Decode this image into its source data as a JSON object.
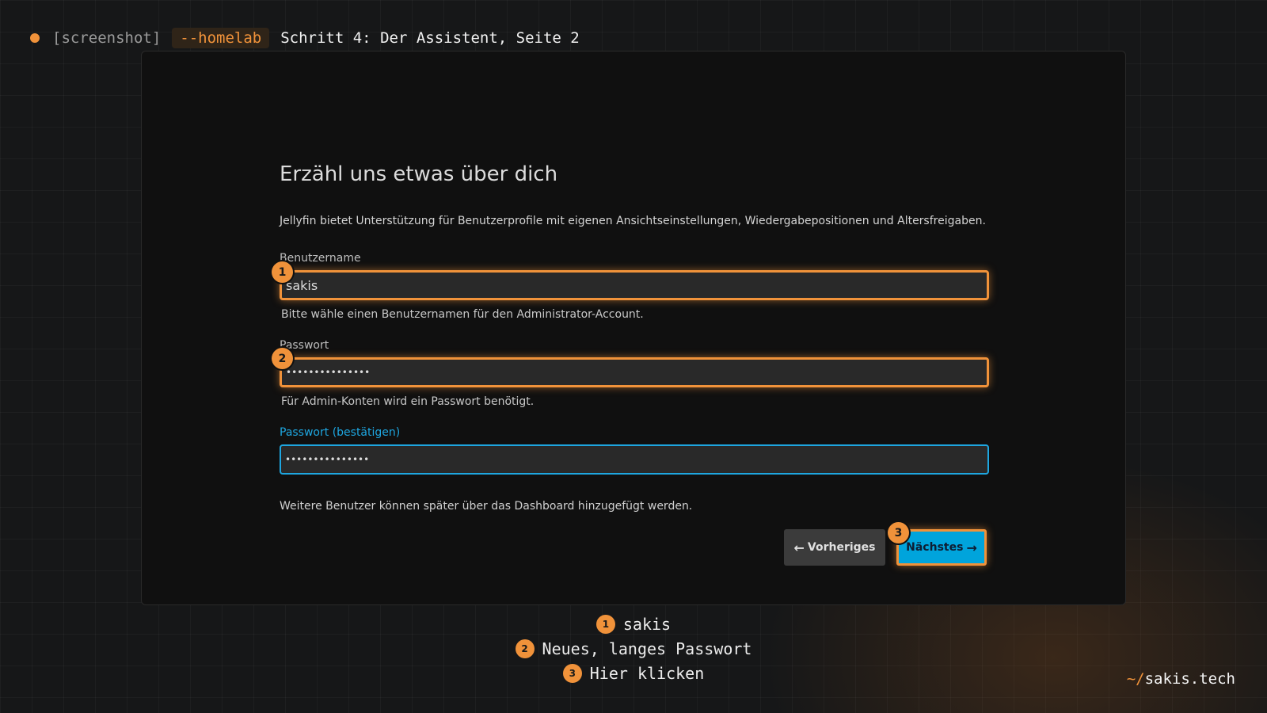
{
  "header": {
    "tag": "[screenshot]",
    "pill": "--homelab",
    "title": "Schritt 4: Der Assistent, Seite 2"
  },
  "form": {
    "title": "Erzähl uns etwas über dich",
    "description": "Jellyfin bietet Unterstützung für Benutzerprofile mit eigenen Ansichtseinstellungen, Wiedergabepositionen und Altersfreigaben.",
    "username": {
      "label": "Benutzername",
      "value": "sakis",
      "help": "Bitte wähle einen Benutzernamen für den Administrator-Account."
    },
    "password": {
      "label": "Passwort",
      "value": "•••••••••••••••",
      "help": "Für Admin-Konten wird ein Passwort benötigt."
    },
    "password_confirm": {
      "label": "Passwort (bestätigen)",
      "value": "•••••••••••••••"
    },
    "note": "Weitere Benutzer können später über das Dashboard hinzugefügt werden.",
    "prev_label": "Vorheriges",
    "next_label": "Nächstes"
  },
  "badges": [
    "1",
    "2",
    "3"
  ],
  "legend": [
    {
      "num": "1",
      "text": "sakis"
    },
    {
      "num": "2",
      "text": "Neues, langes Passwort"
    },
    {
      "num": "3",
      "text": "Hier klicken"
    }
  ],
  "brand": {
    "tilde": "~/",
    "name": "sakis.tech"
  },
  "colors": {
    "accent": "#f0923a",
    "primary": "#00a4dc",
    "focus": "#1ea6e0"
  },
  "icons": {
    "prev": "arrow-left-icon",
    "next": "arrow-right-icon"
  }
}
